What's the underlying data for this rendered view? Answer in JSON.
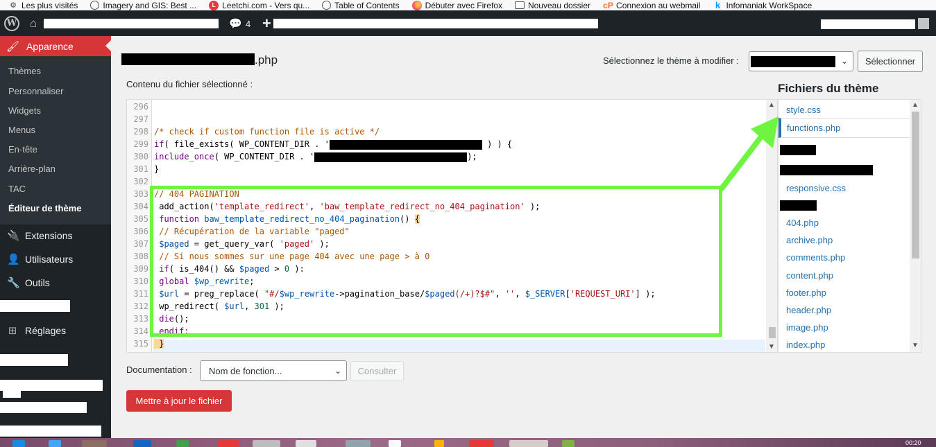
{
  "bookmarks": [
    {
      "label": "Les plus visités",
      "icon": "gear-icon"
    },
    {
      "label": "Imagery and GIS: Best ...",
      "icon": "globe-icon"
    },
    {
      "label": "Leetchi.com - Vers qu...",
      "icon": "leetchi-icon"
    },
    {
      "label": "Table of Contents",
      "icon": "globe-icon"
    },
    {
      "label": "Débuter avec Firefox",
      "icon": "firefox-icon"
    },
    {
      "label": "Nouveau dossier",
      "icon": "folder-icon"
    },
    {
      "label": "Connexion au webmail",
      "icon": "cp-icon"
    },
    {
      "label": "Infomaniak WorkSpace",
      "icon": "infomaniak-icon"
    }
  ],
  "adminbar": {
    "comment_count": "4",
    "plus": "+"
  },
  "sidebar": {
    "current_menu": "Apparence",
    "submenu": [
      "Thèmes",
      "Personnaliser",
      "Widgets",
      "Menus",
      "En-tête",
      "Arrière-plan",
      "TAC",
      "Éditeur de thème"
    ],
    "active_submenu": "Éditeur de thème",
    "menu": [
      "Extensions",
      "Utilisateurs",
      "Outils",
      "Réglages"
    ]
  },
  "page": {
    "title_ext": ".php",
    "theme_select_label": "Sélectionnez le thème à modifier :",
    "select_button": "Sélectionner",
    "content_label": "Contenu du fichier sélectionné :"
  },
  "editor": {
    "line_numbers": [
      "296",
      "297",
      "298",
      "299",
      "300",
      "301",
      "302",
      "303",
      "304",
      "305",
      "306",
      "307",
      "308",
      "309",
      "310",
      "311",
      "312",
      "313",
      "314",
      "315"
    ]
  },
  "files": {
    "title": "Fichiers du thème",
    "items": [
      "style.css",
      "functions.php",
      "responsive.css",
      "404.php",
      "archive.php",
      "comments.php",
      "content.php",
      "footer.php",
      "header.php",
      "image.php",
      "index.php"
    ],
    "current": "functions.php"
  },
  "footer": {
    "doc_label": "Documentation :",
    "doc_select": "Nom de fonction...",
    "consult": "Consulter",
    "update": "Mettre à jour le fichier"
  },
  "taskbar": {
    "clock": "00:20"
  },
  "colors": {
    "highlight": "#6ff53f",
    "admin_dark": "#1d2327",
    "accent_red": "#d63638",
    "link_blue": "#2271b1"
  }
}
